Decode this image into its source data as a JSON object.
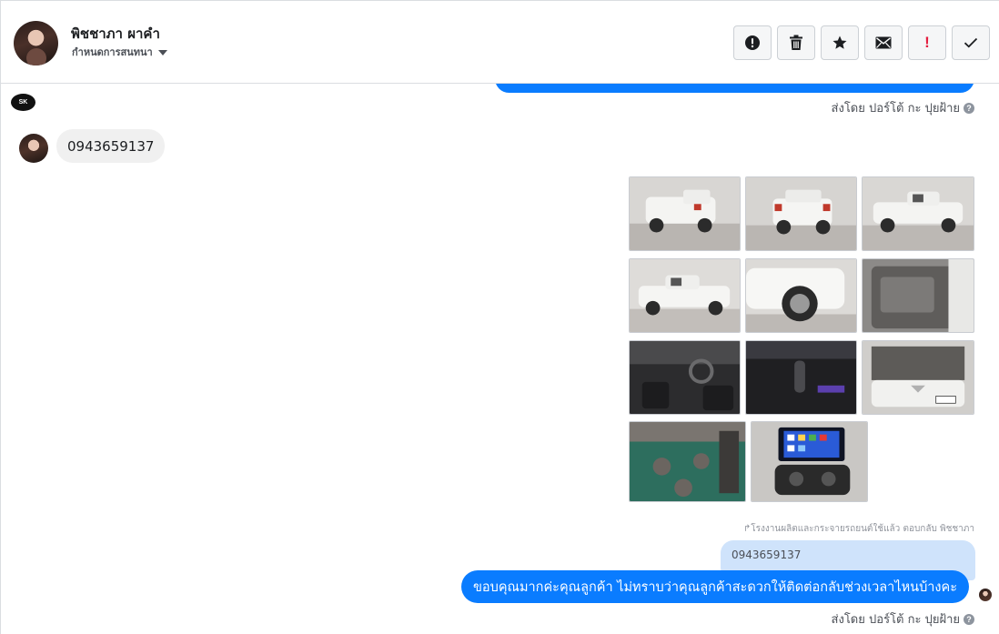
{
  "header": {
    "contact_name": "พิชชาภา ผาคำ",
    "assign_label": "กำหนดการสนทนา",
    "actions": [
      {
        "id": "spam",
        "icon": "alert-circle-icon",
        "label": "Mark as spam"
      },
      {
        "id": "delete",
        "icon": "trash-icon",
        "label": "Delete"
      },
      {
        "id": "star",
        "icon": "star-icon",
        "label": "Star"
      },
      {
        "id": "unread",
        "icon": "envelope-icon",
        "label": "Mark as unread"
      },
      {
        "id": "follow_up",
        "icon": "exclamation-icon",
        "label": "!"
      },
      {
        "id": "done",
        "icon": "check-icon",
        "label": "Done"
      }
    ]
  },
  "messages": {
    "sent_by_1": "ส่งโดย ปอร์โต้ กะ ปุยฝ้าย",
    "page_logo_text": "SK",
    "phone_message": "0943659137",
    "gallery": {
      "photo_count": 11,
      "photos": [
        {
          "name": "truck-rear-left"
        },
        {
          "name": "truck-rear"
        },
        {
          "name": "truck-side-right"
        },
        {
          "name": "truck-side-left"
        },
        {
          "name": "truck-wheel-front"
        },
        {
          "name": "door-interior"
        },
        {
          "name": "dashboard-interior"
        },
        {
          "name": "gear-shifter"
        },
        {
          "name": "engine-bay"
        },
        {
          "name": "battery-terminals"
        },
        {
          "name": "touchscreen-radio"
        }
      ]
    },
    "reply_note": "↱โรงงานผลิตและกระจายรถยนต์ใช้แล้ว ตอบกลับ พิชชาภา",
    "quoted_text": "0943659137",
    "sent_text": "ขอบคุณมากค่ะคุณลูกค้า ไม่ทราบว่าคุณลูกค้าสะดวกให้ติดต่อกลับช่วงเวลาไหนบ้างคะ",
    "sent_by_2": "ส่งโดย ปอร์โต้ กะ ปุยฝ้าย"
  },
  "colors": {
    "bubble_sent": "#0a7cff",
    "bubble_received": "#f0f0f0",
    "bubble_quote": "#cfe3fb",
    "flag_red": "#e41e3f"
  }
}
